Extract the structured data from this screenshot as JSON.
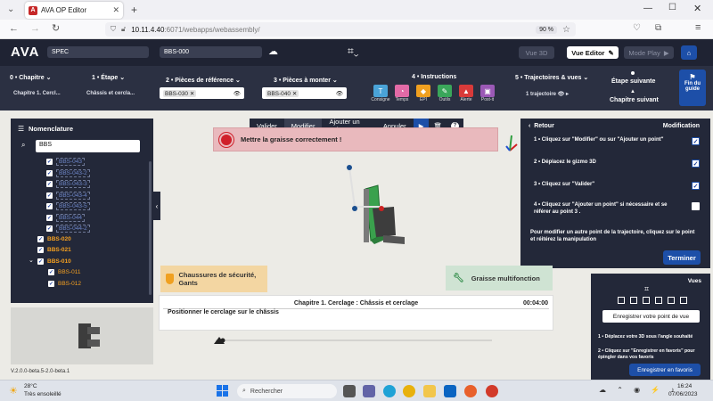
{
  "browser": {
    "tab_title": "AVA OP Editor",
    "favicon": "A",
    "new_tab": "+",
    "url_host": "10.11.4.40",
    "url_rest": ":6071/webapps/webassembly/",
    "zoom": "90 %"
  },
  "header": {
    "logo": "AVA",
    "project": "SPEC",
    "part": "BBS-000",
    "vue3d": "Vue 3D",
    "vue_editor": "Vue Editor",
    "mode_play": "Mode Play"
  },
  "steps": {
    "chapitre_head": "0 • Chapitre",
    "chapitre_val": "Chapitre 1. Cercl...",
    "etape_head": "1 • Étape",
    "etape_val": "Châssis et cercla...",
    "pieces_ref_head": "2 • Pièces de référence",
    "pieces_ref_chip": "BBS-030",
    "pieces_mont_head": "3 • Pièces à monter",
    "pieces_mont_chip": "BBS-040",
    "instructions_head": "4 • Instructions",
    "instructions": [
      {
        "label": "Consigne",
        "color": "#4aa3d8",
        "icon": "T"
      },
      {
        "label": "Temps",
        "color": "#e26aa6",
        "icon": "◔"
      },
      {
        "label": "EPI",
        "color": "#f0a020",
        "icon": "◆"
      },
      {
        "label": "Outils",
        "color": "#3aa65a",
        "icon": "✎"
      },
      {
        "label": "Alerte",
        "color": "#d83a3a",
        "icon": "▲"
      },
      {
        "label": "Post-it",
        "color": "#9b59b6",
        "icon": "▣"
      }
    ],
    "traj_head": "5 • Trajectoires & vues",
    "traj_val": "1 trajectoire",
    "etape_suivante": "Étape suivante",
    "chapitre_suivant": "Chapitre suivant",
    "fin_du_guide": "Fin du guide"
  },
  "nomenclature": {
    "title": "Nomenclature",
    "search_value": "BBS",
    "items": [
      {
        "label": "BBS-043",
        "style": "dash"
      },
      {
        "label": "BBS-043-2",
        "style": "dash"
      },
      {
        "label": "BBS-043-3",
        "style": "dash"
      },
      {
        "label": "BBS-043-4",
        "style": "dash"
      },
      {
        "label": "BBS-043-5",
        "style": "dash"
      },
      {
        "label": "BBS-044",
        "style": "dash"
      },
      {
        "label": "BBS-044-2",
        "style": "dash"
      },
      {
        "label": "BBS-020",
        "style": "orange"
      },
      {
        "label": "BBS-021",
        "style": "orange"
      },
      {
        "label": "BBS-010",
        "style": "orange"
      },
      {
        "label": "BBS-011",
        "style": "orange-sub"
      },
      {
        "label": "BBS-012",
        "style": "orange-sub"
      }
    ]
  },
  "context_toolbar": {
    "valider": "Valider",
    "modifier": "Modifier",
    "ajouter": "Ajouter un point",
    "annuler": "Annuler"
  },
  "alert_text": "Mettre la graisse correctement !",
  "guide": {
    "retour": "Retour",
    "title": "Modification",
    "steps": [
      {
        "text": "1 • Cliquez sur \"Modifier\" ou sur \"Ajouter un point\"",
        "checked": true
      },
      {
        "text": "2 • Déplacez le gizmo 3D",
        "checked": true
      },
      {
        "text": "3 • Cliquez sur \"Valider\"",
        "checked": true
      },
      {
        "text": "4 • Cliquez sur \"Ajouter un point\" si nécessaire et se référer au point 3 .",
        "checked": false
      }
    ],
    "note": "Pour modifier un autre point de la trajectoire, cliquez sur le point et réitérez la manipulation",
    "terminer": "Terminer"
  },
  "vues": {
    "title": "Vues",
    "save_view": "Enregistrer votre point de vue",
    "hint1": "1 • Déplacez votre 3D sous l'angle souhaité",
    "hint2": "2 • Cliquez sur \"Enregistrer en favoris\" pour épingler dans vos favoris",
    "save_fav": "Enregistrer en favoris"
  },
  "safety_text": "Chaussures de sécurité, Gants",
  "grease_text": "Graisse multifonction",
  "chapter_panel": {
    "title": "Chapitre 1. Cerclage : Châssis et cerclage",
    "time": "00:04:00",
    "instruction": "Positionner le cerclage sur le châssis"
  },
  "version": "V.2.0.0-beta.5-2.0-beta.1",
  "taskbar": {
    "temp": "28°C",
    "weather": "Très ensoleillé",
    "search": "Rechercher",
    "time": "16:24",
    "date": "07/06/2023"
  }
}
